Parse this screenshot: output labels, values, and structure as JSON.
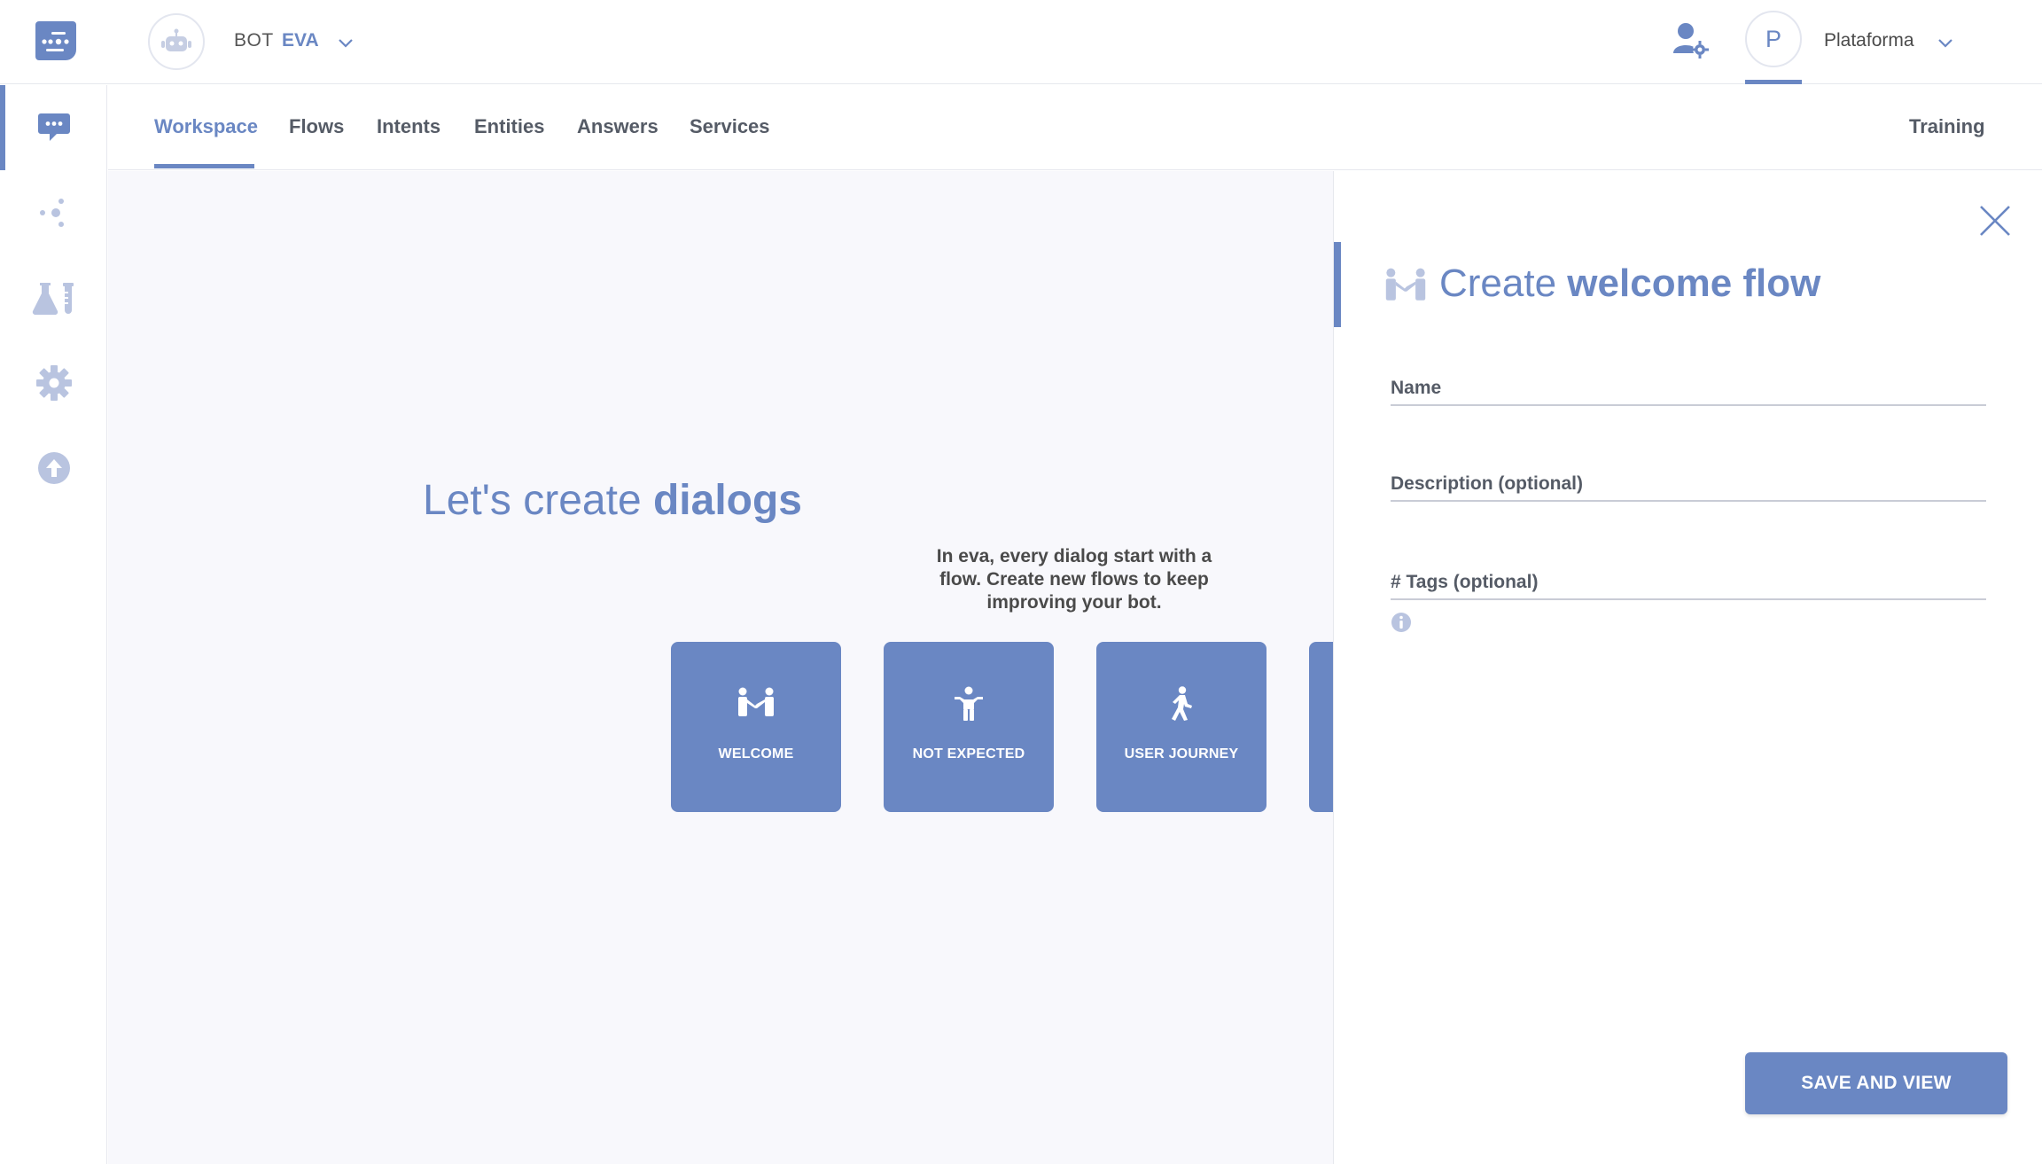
{
  "header": {
    "bot_label": "BOT",
    "bot_name": "EVA",
    "account_initial": "P",
    "account_name": "Plataforma"
  },
  "sidebar": {
    "items": [
      {
        "icon": "chat-icon",
        "active": true
      },
      {
        "icon": "nodes-icon",
        "active": false
      },
      {
        "icon": "lab-icon",
        "active": false
      },
      {
        "icon": "gear-icon",
        "active": false
      },
      {
        "icon": "upload-icon",
        "active": false
      }
    ]
  },
  "tabs": [
    {
      "label": "Workspace",
      "active": true
    },
    {
      "label": "Flows"
    },
    {
      "label": "Intents"
    },
    {
      "label": "Entities"
    },
    {
      "label": "Answers"
    },
    {
      "label": "Services"
    }
  ],
  "training_label": "Training",
  "hero": {
    "title_prefix": "Let's create ",
    "title_strong": "dialogs",
    "subtitle": "In eva, every dialog start with a flow. Create new flows to keep improving your bot."
  },
  "cards": [
    {
      "label": "WELCOME",
      "icon": "handshake-icon"
    },
    {
      "label": "NOT EXPECTED",
      "icon": "shrug-person-icon"
    },
    {
      "label": "USER JOURNEY",
      "icon": "walking-person-icon"
    }
  ],
  "panel": {
    "title_prefix": "Create ",
    "title_strong": "welcome flow",
    "fields": [
      {
        "label": "Name"
      },
      {
        "label": "Description (optional)"
      },
      {
        "label": "# Tags (optional)"
      }
    ],
    "save_label": "SAVE AND VIEW"
  },
  "colors": {
    "accent": "#6a87c3",
    "canvas_bg": "#f8f8fc",
    "icon_muted": "#b9c4e0"
  }
}
